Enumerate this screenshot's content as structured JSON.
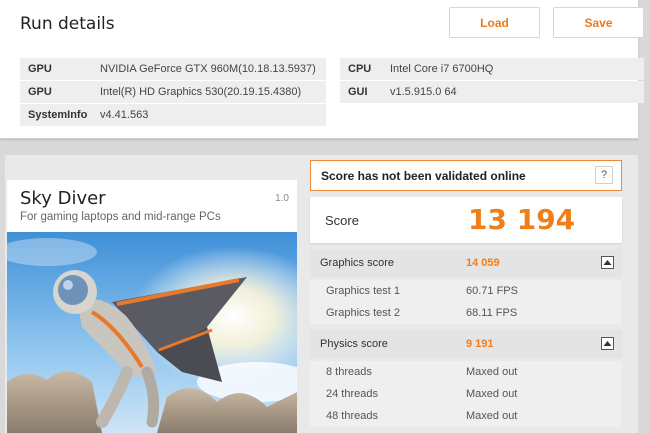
{
  "run_details": {
    "title": "Run details",
    "load_label": "Load",
    "save_label": "Save",
    "left": [
      {
        "key": "GPU",
        "value": "NVIDIA GeForce GTX 960M(10.18.13.5937)"
      },
      {
        "key": "GPU",
        "value": "Intel(R) HD Graphics 530(20.19.15.4380)"
      },
      {
        "key": "SystemInfo",
        "value": "v4.41.563"
      }
    ],
    "right": [
      {
        "key": "CPU",
        "value": "Intel Core i7 6700HQ"
      },
      {
        "key": "GUI",
        "value": "v1.5.915.0 64"
      }
    ]
  },
  "test": {
    "name": "Sky Diver",
    "version": "1.0",
    "description": "For gaming laptops and mid-range PCs"
  },
  "validation": {
    "message": "Score has not been validated online",
    "help_label": "?"
  },
  "score": {
    "label": "Score",
    "value": "13 194"
  },
  "graphics": {
    "label": "Graphics score",
    "value": "14 059",
    "tests": [
      {
        "name": "Graphics test 1",
        "value": "60.71 FPS"
      },
      {
        "name": "Graphics test 2",
        "value": "68.11 FPS"
      }
    ]
  },
  "physics": {
    "label": "Physics score",
    "value": "9 191",
    "tests": [
      {
        "name": "8 threads",
        "value": "Maxed out"
      },
      {
        "name": "24 threads",
        "value": "Maxed out"
      },
      {
        "name": "48 threads",
        "value": "Maxed out"
      }
    ]
  },
  "colors": {
    "accent": "#ef7f1a",
    "panel_bg": "#ffffff",
    "row_bg": "#eeeeee"
  },
  "icons": {
    "collapse": "collapse-up-icon",
    "help": "help-icon"
  }
}
